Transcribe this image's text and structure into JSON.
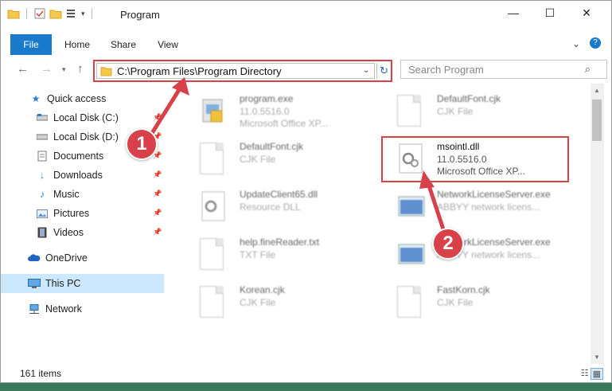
{
  "window": {
    "title": "Program",
    "controls": {
      "minimize": "—",
      "maximize": "☐",
      "close": "✕"
    }
  },
  "ribbon": {
    "tabs": [
      "File",
      "Home",
      "Share",
      "View"
    ],
    "expand_icon": "chevron-down-icon",
    "help_icon": "help-icon"
  },
  "nav": {
    "back_icon": "arrow-left-icon",
    "forward_icon": "arrow-right-icon",
    "recent_icon": "chevron-down-icon",
    "up_icon": "arrow-up-icon"
  },
  "address": {
    "path": "C:\\Program Files\\Program Directory"
  },
  "search": {
    "placeholder": "Search Program"
  },
  "sidebar": {
    "items": [
      {
        "label": "Quick access",
        "icon": "star-icon",
        "pinned": false
      },
      {
        "label": "Local Disk (C:)",
        "icon": "drive-icon",
        "pinned": true
      },
      {
        "label": "Local Disk (D:)",
        "icon": "drive-icon",
        "pinned": true
      },
      {
        "label": "Documents",
        "icon": "documents-icon",
        "pinned": true
      },
      {
        "label": "Downloads",
        "icon": "download-icon",
        "pinned": true
      },
      {
        "label": "Music",
        "icon": "music-icon",
        "pinned": true
      },
      {
        "label": "Pictures",
        "icon": "pictures-icon",
        "pinned": true
      },
      {
        "label": "Videos",
        "icon": "videos-icon",
        "pinned": true
      },
      {
        "label": "OneDrive",
        "icon": "cloud-icon",
        "pinned": false
      },
      {
        "label": "This PC",
        "icon": "computer-icon",
        "pinned": false,
        "selected": true
      },
      {
        "label": "Network",
        "icon": "network-icon",
        "pinned": false
      }
    ]
  },
  "files": [
    {
      "name": "program.exe",
      "line2": "11.0.5516.0",
      "line3": "Microsoft Office XP..."
    },
    {
      "name": "DefaultFont.cjk",
      "line2": "CJK File",
      "line3": ""
    },
    {
      "name": "DefaultFont.cjk",
      "line2": "CJK File",
      "line3": ""
    },
    {
      "name": "msointl.dll",
      "line2": "11.0.5516.0",
      "line3": "Microsoft Office XP..."
    },
    {
      "name": "UpdateClient65.dll",
      "line2": "Resource DLL",
      "line3": ""
    },
    {
      "name": "NetworkLicenseServer.exe",
      "line2": "ABBYY network licens...",
      "line3": ""
    },
    {
      "name": "help.fineReader.txt",
      "line2": "TXT File",
      "line3": ""
    },
    {
      "name": "NetworkLicenseServer.exe",
      "line2": "ABBYY network licens...",
      "line3": ""
    },
    {
      "name": "Korean.cjk",
      "line2": "CJK File",
      "line3": ""
    },
    {
      "name": "FastKorn.cjk",
      "line2": "CJK File",
      "line3": ""
    }
  ],
  "status": {
    "item_count": "161 items"
  },
  "annotations": {
    "step1": "1",
    "step2": "2",
    "highlight_color": "#d9414a"
  },
  "colors": {
    "accent": "#1979ca",
    "selection": "#cce8ff",
    "highlight": "#d9414a"
  }
}
